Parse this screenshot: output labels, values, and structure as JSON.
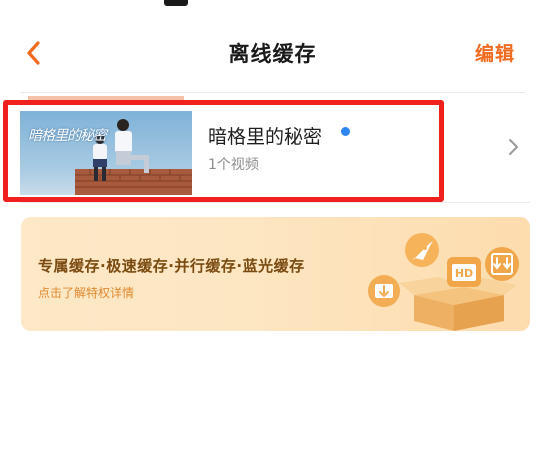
{
  "header": {
    "title": "离线缓存",
    "edit_label": "编辑",
    "back_icon": "chevron-left-icon",
    "accent_color": "#f06a1f"
  },
  "cache_items": [
    {
      "name": "暗格里的秘密",
      "count_text": "1个视频",
      "thumbnail_title": "暗格里的秘密",
      "has_new": true,
      "new_dot_color": "#2f86f0",
      "highlighted": true,
      "highlight_color": "#f0201e"
    }
  ],
  "promo": {
    "title": "专属缓存·极速缓存·并行缓存·蓝光缓存",
    "subtitle": "点击了解特权详情",
    "icons": [
      "rocket-icon",
      "hd-icon",
      "download-folder-icon",
      "download-icon",
      "box-icon"
    ],
    "hd_text": "HD"
  }
}
